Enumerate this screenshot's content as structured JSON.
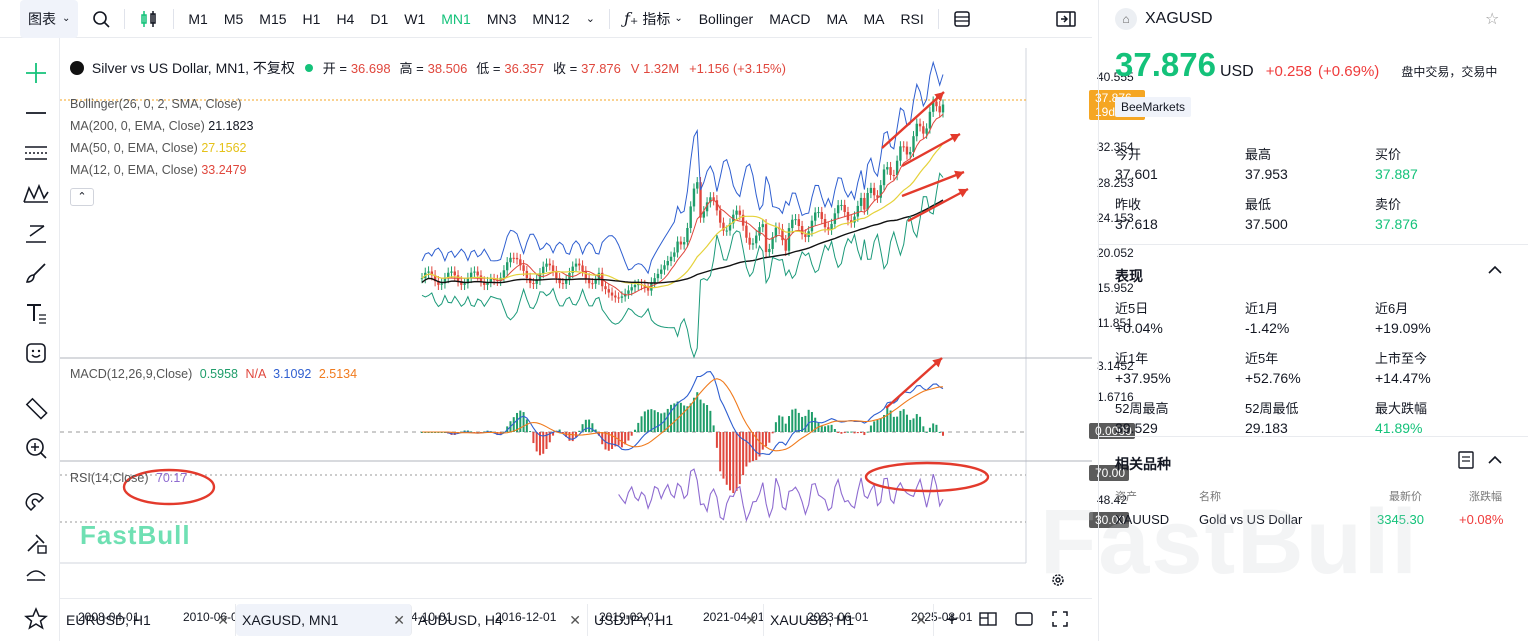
{
  "toolbar": {
    "chart_type": "图表",
    "timeframes": [
      "M1",
      "M5",
      "M15",
      "H1",
      "H4",
      "D1",
      "W1",
      "MN1",
      "MN3",
      "MN12"
    ],
    "active_timeframe": "MN1",
    "indicators_label": "指标",
    "indicator_shortcuts": [
      "Bollinger",
      "MACD",
      "MA",
      "MA",
      "RSI"
    ]
  },
  "legend": {
    "title": "Silver vs US Dollar, MN1, 不复权",
    "open_label": "开 =",
    "open": "36.698",
    "high_label": "高 =",
    "high": "38.506",
    "low_label": "低 =",
    "low": "36.357",
    "close_label": "收 =",
    "close": "37.876",
    "volume": "V 1.32M",
    "change": "+1.156 (+3.15%)",
    "bollinger": "Bollinger(26, 0, 2, SMA, Close)",
    "ma200": "MA(200, 0, EMA, Close)",
    "ma200_val": "21.1823",
    "ma50": "MA(50, 0, EMA, Close)",
    "ma50_val": "27.1562",
    "ma12": "MA(12, 0, EMA, Close)",
    "ma12_val": "33.2479",
    "macd": "MACD(12,26,9,Close)",
    "macd_hist": "0.5958",
    "macd_na": "N/A",
    "macd_line": "3.1092",
    "macd_signal": "2.5134",
    "rsi": "RSI(14,Close)",
    "rsi_val": "70.17"
  },
  "axis": {
    "price_labels": [
      "40.555",
      "32.354",
      "28.253",
      "24.153",
      "20.052",
      "15.952",
      "11.851"
    ],
    "macd_labels": [
      "3.1452",
      "1.6716",
      "0.0000"
    ],
    "rsi_labels": [
      "70.00",
      "48.42",
      "30.00"
    ],
    "price_tag": "37.876",
    "price_tag_time": "19d 15h",
    "dates": [
      "2008-04-01",
      "2010-06-01",
      "2012-08-01",
      "2014-10-01",
      "2016-12-01",
      "2019-02-01",
      "2021-04-01",
      "2023-06-01",
      "2025-08-01"
    ]
  },
  "watermark": "FastBull",
  "bottom_tabs": [
    {
      "label": "EURUSD, H1"
    },
    {
      "label": "XAGUSD, MN1"
    },
    {
      "label": "AUDUSD, H4"
    },
    {
      "label": "USDJPY, H1"
    },
    {
      "label": "XAUUSD, H1"
    }
  ],
  "panel": {
    "symbol": "XAGUSD",
    "price": "37.876",
    "currency": "USD",
    "change": "+0.258",
    "change_pct": "(+0.69%)",
    "status": "盘中交易，交易中",
    "source": "BeeMarkets",
    "quote": [
      {
        "label": "今开",
        "value": "37.601"
      },
      {
        "label": "最高",
        "value": "37.953"
      },
      {
        "label": "买价",
        "value": "37.887"
      },
      {
        "label": "昨收",
        "value": "37.618"
      },
      {
        "label": "最低",
        "value": "37.500"
      },
      {
        "label": "卖价",
        "value": "37.876"
      }
    ],
    "performance_title": "表现",
    "performance": [
      {
        "label": "近5日",
        "value": "+0.04%"
      },
      {
        "label": "近1月",
        "value": "-1.42%"
      },
      {
        "label": "近6月",
        "value": "+19.09%"
      },
      {
        "label": "近1年",
        "value": "+37.95%"
      },
      {
        "label": "近5年",
        "value": "+52.76%"
      },
      {
        "label": "上市至今",
        "value": "+14.47%"
      },
      {
        "label": "52周最高",
        "value": "39.529"
      },
      {
        "label": "52周最低",
        "value": "29.183"
      },
      {
        "label": "最大跌幅",
        "value": "41.89%"
      }
    ],
    "related_title": "相关品种",
    "related_headers": [
      "资产",
      "名称",
      "最新价",
      "涨跌幅"
    ],
    "related_row": {
      "asset": "XAUUSD",
      "name": "Gold vs US Dollar",
      "price": "3345.30",
      "change": "+0.08%"
    }
  },
  "colors": {
    "green": "#14c27a",
    "red": "#ef3b3b",
    "bull": "#1f9d6a",
    "bear": "#e0473d",
    "boll": "#2f5fd0",
    "ma200": "#111111",
    "ma50": "#e5d23a",
    "ma12": "#e0473d",
    "accent_tag": "#f5a623"
  }
}
